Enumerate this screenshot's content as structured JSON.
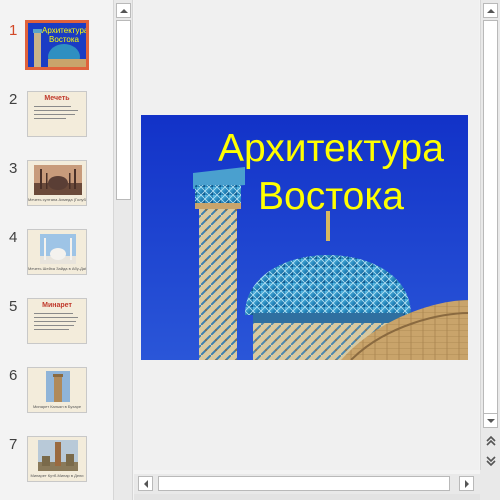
{
  "thumbnails": [
    {
      "number": "1",
      "title": "Архитектура Востока",
      "selected": true
    },
    {
      "number": "2",
      "title": "Мечеть",
      "caption": ""
    },
    {
      "number": "3",
      "caption": "Мечеть султана Ахмеда (Голубая мечеть), Стамбул"
    },
    {
      "number": "4",
      "caption": "Мечеть Шейха Зайда в Абу-Даби"
    },
    {
      "number": "5",
      "title": "Минарет",
      "caption": ""
    },
    {
      "number": "6",
      "caption": "Минарет Кальян в Бухаре"
    },
    {
      "number": "7",
      "caption": "Минарет Кутб-Минар в Дели"
    }
  ],
  "slide": {
    "title_line1": "Архитектура",
    "title_line2": "Востока",
    "title_color": "#ffff00"
  },
  "colors": {
    "accent": "#d24726",
    "selection_border": "#e0623c",
    "sky": "#1a3cc4"
  }
}
